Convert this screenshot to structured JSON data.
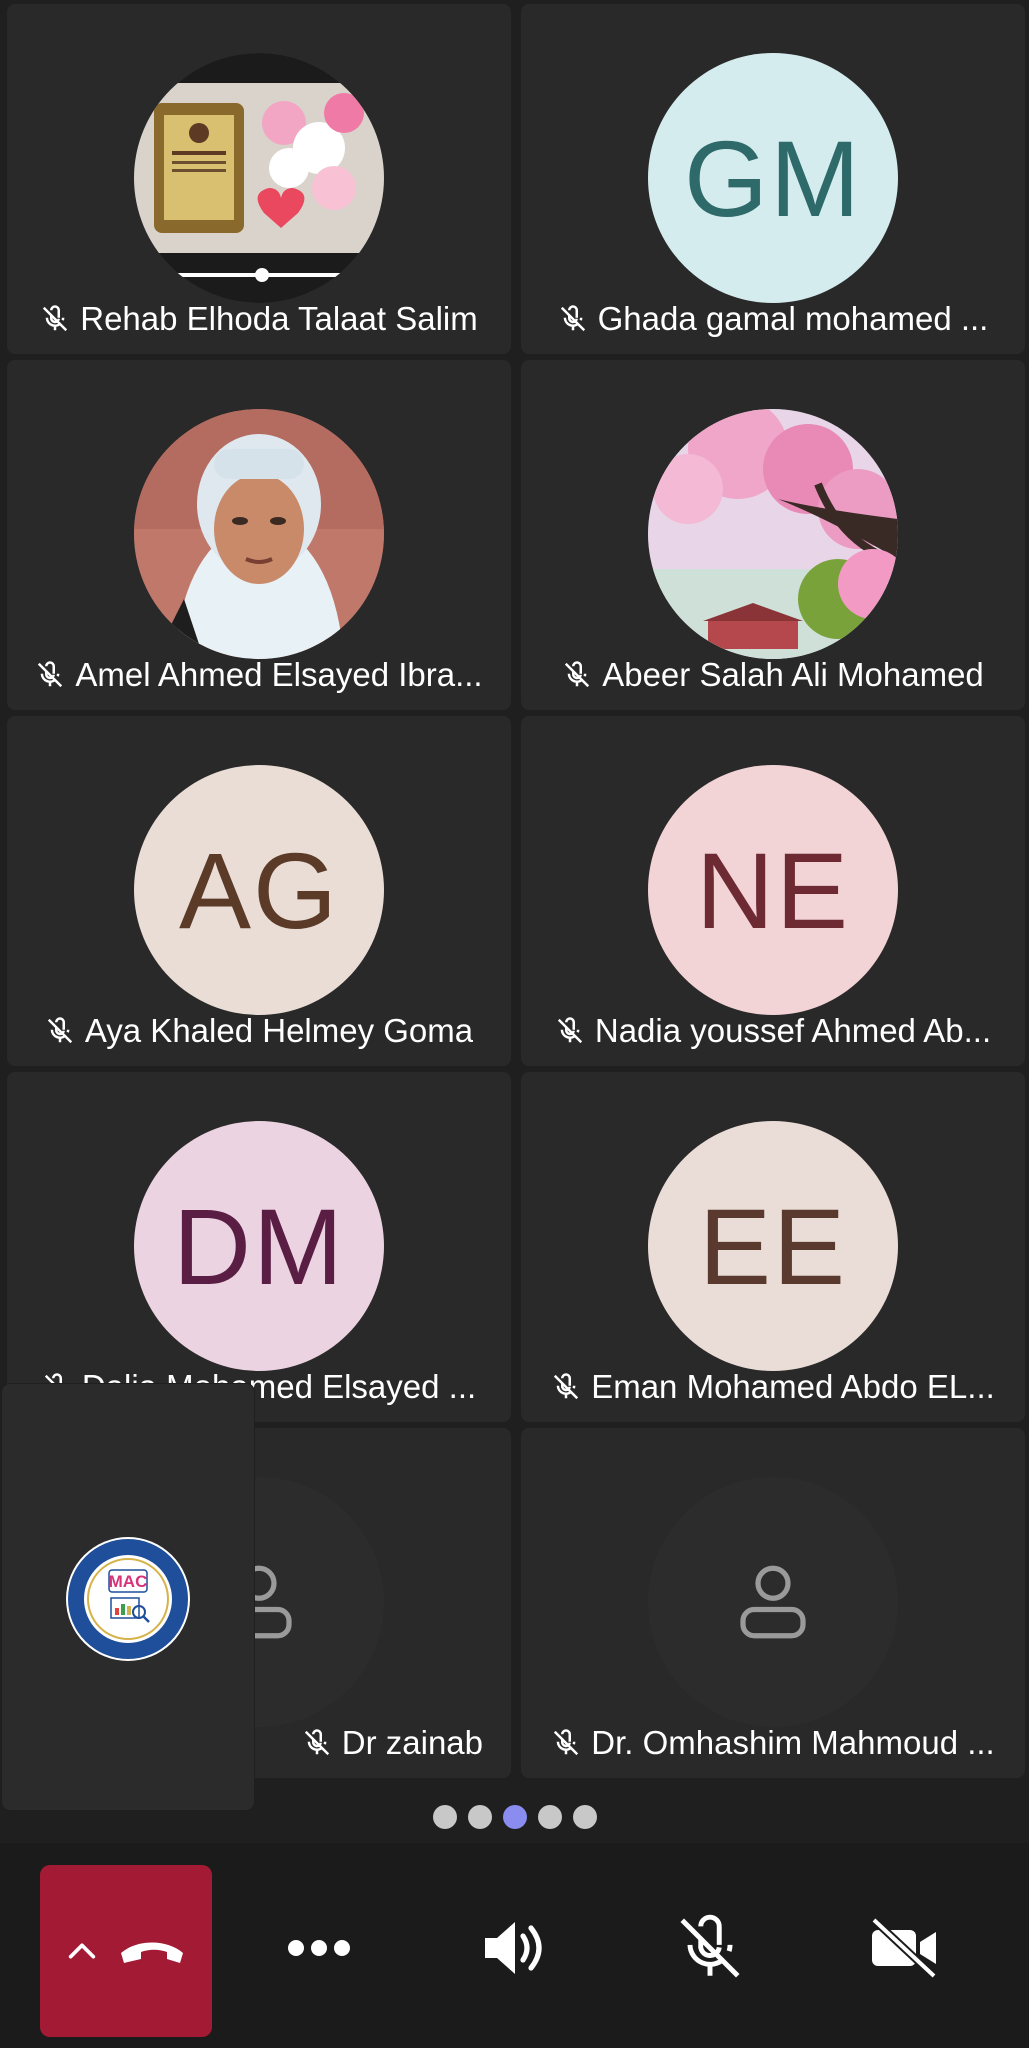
{
  "participants": [
    {
      "name": "Rehab Elhoda Talaat Salim",
      "type": "photo",
      "photo": "plaque-flowers"
    },
    {
      "name": "Ghada gamal mohamed ...",
      "type": "initials",
      "initials": "GM",
      "bg": "#d5ecef",
      "fg": "#2f6a6a"
    },
    {
      "name": "Amel Ahmed Elsayed Ibra...",
      "type": "photo",
      "photo": "woman-portrait"
    },
    {
      "name": "Abeer Salah Ali Mohamed",
      "type": "photo",
      "photo": "pink-tree"
    },
    {
      "name": "Aya Khaled Helmey Goma",
      "type": "initials",
      "initials": "AG",
      "bg": "#e9ddd6",
      "fg": "#5b3a28"
    },
    {
      "name": "Nadia youssef Ahmed Ab...",
      "type": "initials",
      "initials": "NE",
      "bg": "#f2d3d6",
      "fg": "#6e2a33"
    },
    {
      "name": "Dalia Mohamed Elsayed ...",
      "type": "initials",
      "initials": "DM",
      "bg": "#ecd3e1",
      "fg": "#5a1e44"
    },
    {
      "name": "Eman Mohamed Abdo EL...",
      "type": "initials",
      "initials": "EE",
      "bg": "#eadcd6",
      "fg": "#5a3a2e"
    },
    {
      "name": "Dr zainab",
      "type": "placeholder"
    },
    {
      "name": "Dr. Omhashim Mahmoud ...",
      "type": "placeholder"
    }
  ],
  "self_view": {
    "logo_text": "MAC"
  },
  "pagination": {
    "pages": 5,
    "current": 3
  },
  "controls": {
    "hangup": "hang-up-icon",
    "more": "more-options-icon",
    "speaker": "speaker-icon",
    "mic": "mic-off-icon",
    "camera": "camera-off-icon"
  },
  "colors": {
    "hangup_bg": "#a31a35",
    "tile_bg": "#292929",
    "page_bg": "#1f1f1f",
    "active_dot": "#8b8cf0"
  }
}
